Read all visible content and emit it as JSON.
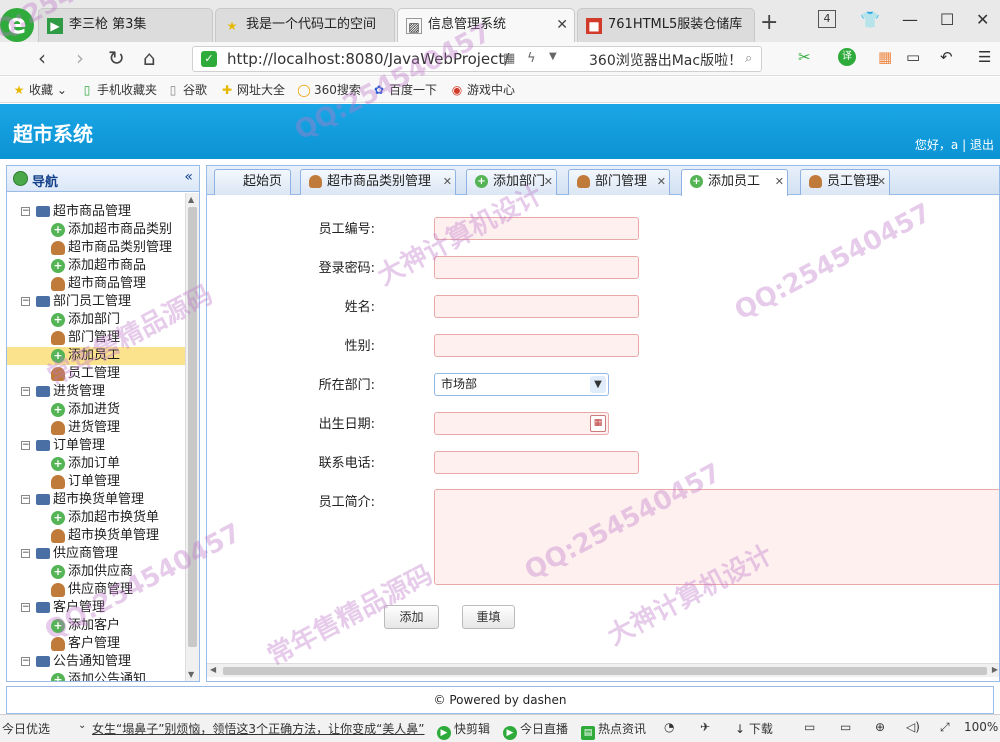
{
  "browser": {
    "logo": "e",
    "tabs": [
      {
        "label": "李三枪 第3集",
        "icon": "video-icon"
      },
      {
        "label": "我是一个代码工的空间",
        "icon": "star-icon"
      },
      {
        "label": "信息管理系统",
        "icon": "image-icon"
      },
      {
        "label": "761HTML5服装仓储库",
        "icon": "site-icon"
      }
    ],
    "tab_count": "4",
    "address": {
      "url": "http://localhost:8080/JavaWebProject/",
      "promo": "360浏览器出Mac版啦！"
    },
    "bookmarks": [
      "收藏",
      "手机收藏夹",
      "谷歌",
      "网址大全",
      "360搜索",
      "百度一下",
      "游戏中心"
    ]
  },
  "app": {
    "title": "超市系统",
    "greeting": "您好，a",
    "logout": "退出",
    "separator": "|"
  },
  "nav": {
    "title": "导航",
    "groups": [
      {
        "label": "超市商品管理",
        "items": [
          {
            "label": "添加超市商品类别",
            "icon": "plus"
          },
          {
            "label": "超市商品类别管理",
            "icon": "user"
          },
          {
            "label": "添加超市商品",
            "icon": "plus"
          },
          {
            "label": "超市商品管理",
            "icon": "user"
          }
        ]
      },
      {
        "label": "部门员工管理",
        "items": [
          {
            "label": "添加部门",
            "icon": "plus"
          },
          {
            "label": "部门管理",
            "icon": "user"
          },
          {
            "label": "添加员工",
            "icon": "plus",
            "selected": true
          },
          {
            "label": "员工管理",
            "icon": "user"
          }
        ]
      },
      {
        "label": "进货管理",
        "items": [
          {
            "label": "添加进货",
            "icon": "plus"
          },
          {
            "label": "进货管理",
            "icon": "user"
          }
        ]
      },
      {
        "label": "订单管理",
        "items": [
          {
            "label": "添加订单",
            "icon": "plus"
          },
          {
            "label": "订单管理",
            "icon": "user"
          }
        ]
      },
      {
        "label": "超市换货单管理",
        "items": [
          {
            "label": "添加超市换货单",
            "icon": "plus"
          },
          {
            "label": "超市换货单管理",
            "icon": "user"
          }
        ]
      },
      {
        "label": "供应商管理",
        "items": [
          {
            "label": "添加供应商",
            "icon": "plus"
          },
          {
            "label": "供应商管理",
            "icon": "user"
          }
        ]
      },
      {
        "label": "客户管理",
        "items": [
          {
            "label": "添加客户",
            "icon": "plus"
          },
          {
            "label": "客户管理",
            "icon": "user"
          }
        ]
      },
      {
        "label": "公告通知管理",
        "items": [
          {
            "label": "添加公告通知",
            "icon": "plus"
          }
        ]
      }
    ]
  },
  "content_tabs": [
    {
      "label": "起始页",
      "icon": "",
      "closable": false
    },
    {
      "label": "超市商品类别管理",
      "icon": "user-icon",
      "closable": true
    },
    {
      "label": "添加部门",
      "icon": "plus-icon",
      "closable": true
    },
    {
      "label": "部门管理",
      "icon": "user-icon",
      "closable": true
    },
    {
      "label": "添加员工",
      "icon": "plus-icon",
      "closable": true,
      "active": true
    },
    {
      "label": "员工管理",
      "icon": "user-icon",
      "closable": true
    }
  ],
  "form": {
    "employee_no_label": "员工编号:",
    "password_label": "登录密码:",
    "name_label": "姓名:",
    "gender_label": "性别:",
    "department_label": "所在部门:",
    "department_value": "市场部",
    "birthday_label": "出生日期:",
    "phone_label": "联系电话:",
    "intro_label": "员工简介:",
    "add_button": "添加",
    "reset_button": "重填"
  },
  "footer": {
    "text": "© Powered by dashen"
  },
  "statusbar": {
    "left": "今日优选",
    "news": "女生“塌鼻子”别烦恼，领悟这3个正确方法，让你变成“美人鼻”",
    "items": [
      "快剪辑",
      "今日直播",
      "热点资讯",
      "下载"
    ],
    "zoom": "100%"
  },
  "watermarks": [
    "QQ:254540457",
    "大神计算机设计",
    "常年售精品源码"
  ]
}
